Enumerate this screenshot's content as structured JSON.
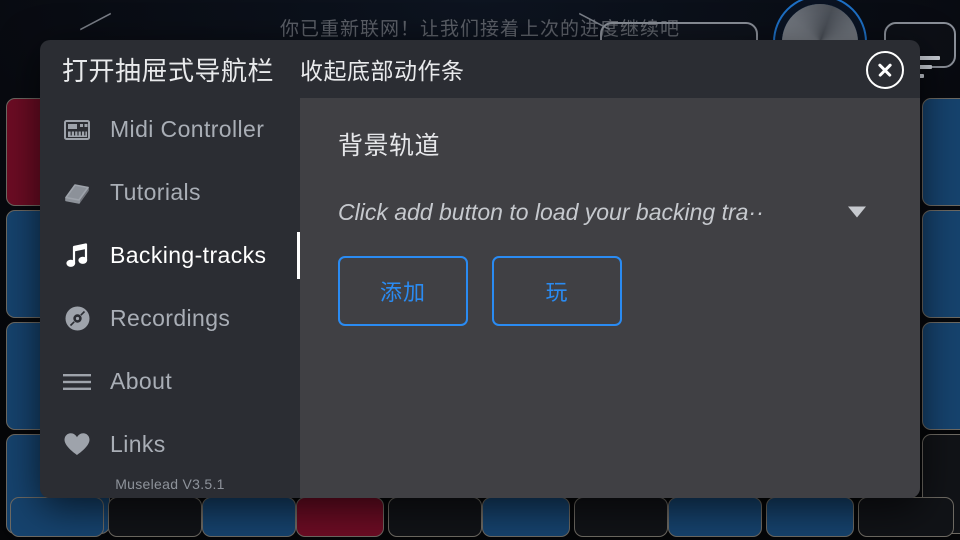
{
  "background": {
    "banner_text": "你已重新联网！让我们接着上次的进度继续吧",
    "knob_name": "rotary-knob",
    "pad_rows": [
      [
        "red",
        "blue",
        "blue",
        "blue"
      ],
      [
        "blue",
        "blue",
        "blue",
        "dark"
      ]
    ],
    "bottom_pads": [
      "blue",
      "dark",
      "blue",
      "red",
      "dark",
      "blue",
      "dark",
      "blue",
      "blue",
      "dark"
    ]
  },
  "dialog": {
    "drawer_title": "打开抽屉式导航栏",
    "panel_header_title": "收起底部动作条",
    "close_label": "×",
    "sidebar": {
      "items": [
        {
          "label": "Midi Controller",
          "icon": "midi-keyboard-icon",
          "selected": false
        },
        {
          "label": "Tutorials",
          "icon": "book-icon",
          "selected": false
        },
        {
          "label": "Backing-tracks",
          "icon": "music-note-icon",
          "selected": true
        },
        {
          "label": "Recordings",
          "icon": "disc-icon",
          "selected": false
        },
        {
          "label": "About",
          "icon": "hamburger-icon",
          "selected": false
        },
        {
          "label": "Links",
          "icon": "heart-icon",
          "selected": false
        }
      ],
      "version": "Muselead V3.5.1"
    },
    "panel": {
      "title": "背景轨道",
      "select_value": "Click add button to load your backing tra··",
      "buttons": [
        {
          "label": "添加",
          "name": "add-backing-track-button"
        },
        {
          "label": "玩",
          "name": "play-backing-track-button"
        }
      ]
    }
  },
  "colors": {
    "dialog_bg": "#2b2d33",
    "panel_bg": "#404044",
    "accent_blue": "#2a8bf2",
    "selected_text": "#ffffff",
    "muted_text": "#a9aeb6",
    "pad_blue": "#16436e",
    "pad_red": "#6d0c24"
  }
}
